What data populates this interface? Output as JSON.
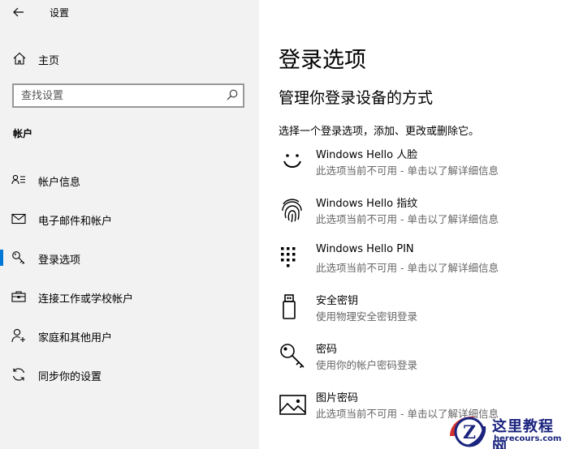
{
  "window": {
    "title": "设置"
  },
  "sidebar": {
    "home_label": "主页",
    "search_placeholder": "查找设置",
    "section_header": "帐户",
    "items": [
      {
        "label": "帐户信息",
        "icon": "account-info-icon",
        "selected": false
      },
      {
        "label": "电子邮件和帐户",
        "icon": "mail-icon",
        "selected": false
      },
      {
        "label": "登录选项",
        "icon": "key-icon",
        "selected": true
      },
      {
        "label": "连接工作或学校帐户",
        "icon": "briefcase-icon",
        "selected": false
      },
      {
        "label": "家庭和其他用户",
        "icon": "person-add-icon",
        "selected": false
      },
      {
        "label": "同步你的设置",
        "icon": "sync-icon",
        "selected": false
      }
    ]
  },
  "main": {
    "title": "登录选项",
    "subtitle": "管理你登录设备的方式",
    "description": "选择一个登录选项，添加、更改或删除它。",
    "options": [
      {
        "title": "Windows Hello 人脸",
        "subtitle": "此选项当前不可用 - 单击以了解详细信息",
        "icon": "face-icon"
      },
      {
        "title": "Windows Hello 指纹",
        "subtitle": "此选项当前不可用 - 单击以了解详细信息",
        "icon": "fingerprint-icon"
      },
      {
        "title": "Windows Hello PIN",
        "subtitle": "此选项当前不可用 - 单击以了解详细信息",
        "icon": "pin-keypad-icon"
      },
      {
        "title": "安全密钥",
        "subtitle": "使用物理安全密钥登录",
        "icon": "usb-key-icon"
      },
      {
        "title": "密码",
        "subtitle": "使用你的帐户密码登录",
        "icon": "password-key-icon"
      },
      {
        "title": "图片密码",
        "subtitle": "此选项当前不可用 - 单击以了解详细信息",
        "icon": "picture-icon"
      }
    ]
  },
  "watermark": {
    "title": "这里教程网",
    "url": "herecours.com",
    "letter": "Z"
  },
  "colors": {
    "accent": "#0078d7",
    "sidebar_bg": "#f2f2f2",
    "secondary_text": "#666666"
  }
}
